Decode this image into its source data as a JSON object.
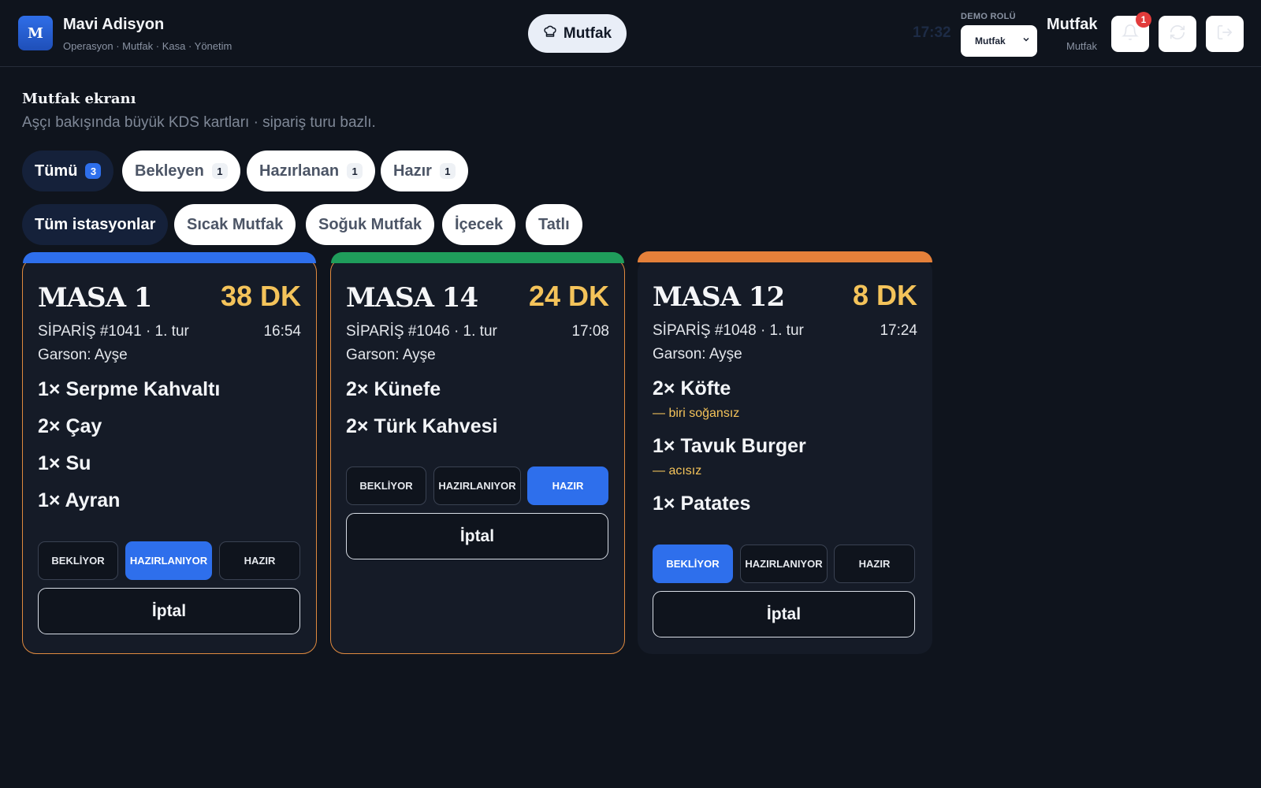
{
  "app": {
    "logo_letter": "M",
    "name": "Mavi Adisyon",
    "subtitle": "Operasyon · Mutfak · Kasa · Yönetim"
  },
  "header": {
    "role_pill": "Mutfak",
    "clock": "17:32",
    "demo_label": "DEMO ROLÜ",
    "demo_select_value": "Mutfak",
    "user_name": "Mutfak",
    "user_role": "Mutfak",
    "notification_count": "1",
    "icons": [
      "bell-icon",
      "refresh-icon",
      "logout-icon"
    ]
  },
  "page": {
    "title": "Mutfak ekranı",
    "subtitle": "Aşçı bakışında büyük KDS kartları · sipariş turu bazlı."
  },
  "status_filters": [
    {
      "label": "Tümü",
      "count": "3",
      "active": true
    },
    {
      "label": "Bekleyen",
      "count": "1",
      "active": false
    },
    {
      "label": "Hazırlanan",
      "count": "1",
      "active": false
    },
    {
      "label": "Hazır",
      "count": "1",
      "active": false
    }
  ],
  "station_filters": [
    {
      "label": "Tüm istasyonlar",
      "active": true
    },
    {
      "label": "Sıcak Mutfak",
      "active": false
    },
    {
      "label": "Soğuk Mutfak",
      "active": false
    },
    {
      "label": "İçecek",
      "active": false
    },
    {
      "label": "Tatlı",
      "active": false
    }
  ],
  "status_labels": [
    "BEKLİYOR",
    "HAZIRLANIYOR",
    "HAZIR"
  ],
  "cancel_label": "İptal",
  "colors": {
    "accent_blue": "#2e6fec",
    "accent_green": "#1f9d5b",
    "accent_orange": "#e4803a",
    "timer_yellow": "#f4c35a"
  },
  "orders": [
    {
      "table": "MASA 1",
      "elapsed": "38 DK",
      "order": "SİPARİŞ #1041 · 1. tur",
      "time": "16:54",
      "waiter": "Garson: Ayşe",
      "status": "HAZIRLANIYOR",
      "items": [
        {
          "text": "1× Serpme Kahvaltı",
          "note": ""
        },
        {
          "text": "2× Çay",
          "note": ""
        },
        {
          "text": "1× Su",
          "note": ""
        },
        {
          "text": "1× Ayran",
          "note": ""
        }
      ]
    },
    {
      "table": "MASA 14",
      "elapsed": "24 DK",
      "order": "SİPARİŞ #1046 · 1. tur",
      "time": "17:08",
      "waiter": "Garson: Ayşe",
      "status": "HAZIR",
      "items": [
        {
          "text": "2× Künefe",
          "note": ""
        },
        {
          "text": "2× Türk Kahvesi",
          "note": ""
        }
      ]
    },
    {
      "table": "MASA 12",
      "elapsed": "8 DK",
      "order": "SİPARİŞ #1048 · 1. tur",
      "time": "17:24",
      "waiter": "Garson: Ayşe",
      "status": "BEKLİYOR",
      "items": [
        {
          "text": "2× Köfte",
          "note": "— biri soğansız"
        },
        {
          "text": "1× Tavuk Burger",
          "note": "— acısız"
        },
        {
          "text": "1× Patates",
          "note": ""
        }
      ]
    }
  ]
}
